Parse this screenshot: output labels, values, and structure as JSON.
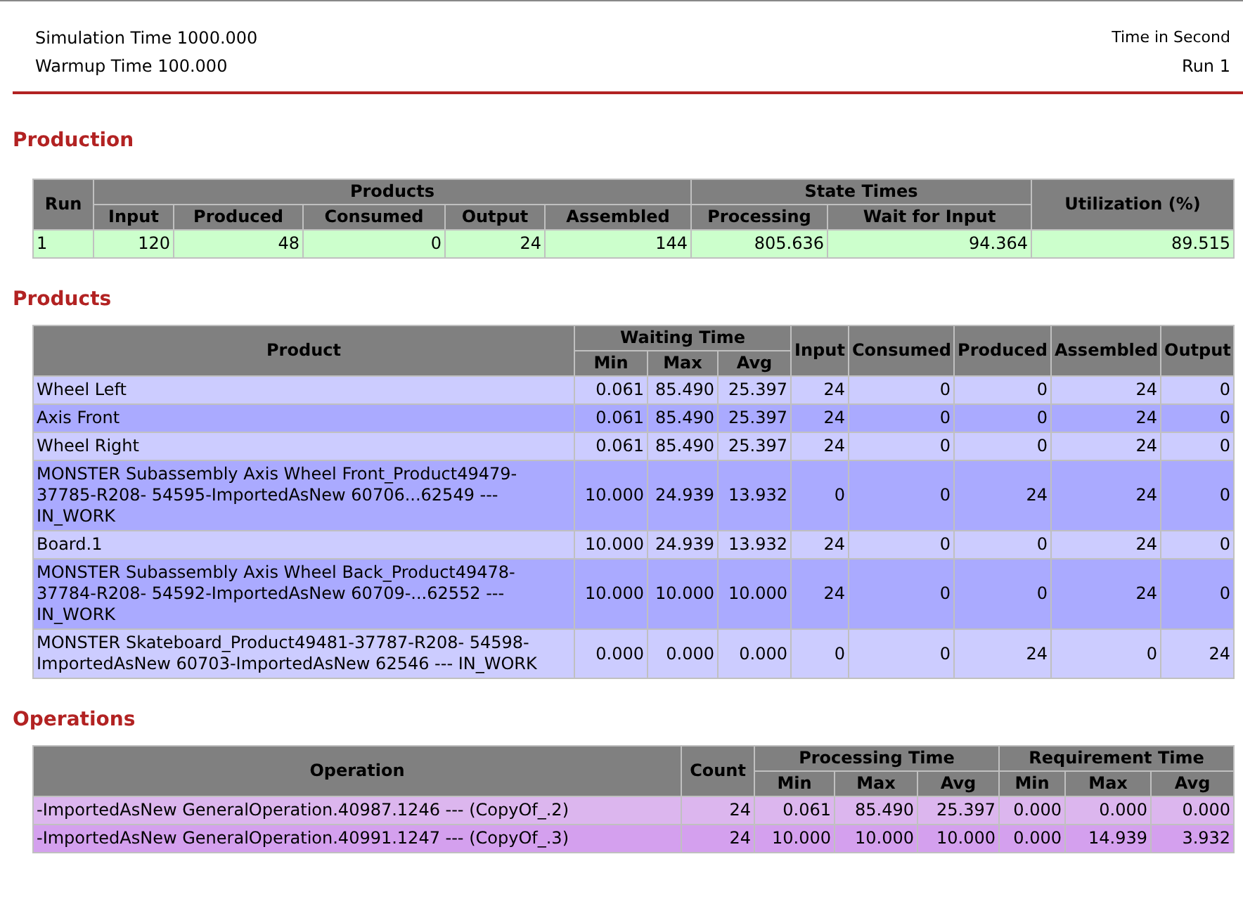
{
  "header": {
    "simulation_time": "Simulation Time 1000.000",
    "warmup_time": "Warmup Time 100.000",
    "time_unit": "Time in Second",
    "run": "Run 1"
  },
  "sections": [
    {
      "title": "Production",
      "table": {
        "header_rows": [
          [
            {
              "text": "Run",
              "rowspan": 2
            },
            {
              "text": "Products",
              "colspan": 5
            },
            {
              "text": "State Times",
              "colspan": 2
            },
            {
              "text": "Utilization (%)",
              "rowspan": 2
            }
          ],
          [
            {
              "text": "Input"
            },
            {
              "text": "Produced"
            },
            {
              "text": "Consumed"
            },
            {
              "text": "Output"
            },
            {
              "text": "Assembled"
            },
            {
              "text": "Processing"
            },
            {
              "text": "Wait for Input"
            }
          ]
        ],
        "rows": [
          [
            "1",
            "120",
            "48",
            "0",
            "24",
            "144",
            "805.636",
            "94.364",
            "89.515"
          ]
        ]
      }
    },
    {
      "title": "Products",
      "table": {
        "header_rows": [
          [
            {
              "text": "Product",
              "rowspan": 2
            },
            {
              "text": "Waiting Time",
              "colspan": 3
            },
            {
              "text": "Input",
              "rowspan": 2
            },
            {
              "text": "Consumed",
              "rowspan": 2
            },
            {
              "text": "Produced",
              "rowspan": 2
            },
            {
              "text": "Assembled",
              "rowspan": 2
            },
            {
              "text": "Output",
              "rowspan": 2
            }
          ],
          [
            {
              "text": "Min"
            },
            {
              "text": "Max"
            },
            {
              "text": "Avg"
            }
          ]
        ],
        "rows": [
          [
            "Wheel Left",
            "0.061",
            "85.490",
            "25.397",
            "24",
            "0",
            "0",
            "24",
            "0"
          ],
          [
            "Axis Front",
            "0.061",
            "85.490",
            "25.397",
            "24",
            "0",
            "0",
            "24",
            "0"
          ],
          [
            "Wheel Right",
            "0.061",
            "85.490",
            "25.397",
            "24",
            "0",
            "0",
            "24",
            "0"
          ],
          [
            "MONSTER Subassembly Axis Wheel Front_Product49479-37785-R208- 54595-ImportedAsNew 60706...62549 --- IN_WORK",
            "10.000",
            "24.939",
            "13.932",
            "0",
            "0",
            "24",
            "24",
            "0"
          ],
          [
            "Board.1",
            "10.000",
            "24.939",
            "13.932",
            "24",
            "0",
            "0",
            "24",
            "0"
          ],
          [
            "MONSTER Subassembly Axis Wheel Back_Product49478-37784-R208- 54592-ImportedAsNew 60709-...62552 --- IN_WORK",
            "10.000",
            "10.000",
            "10.000",
            "24",
            "0",
            "0",
            "24",
            "0"
          ],
          [
            "MONSTER Skateboard_Product49481-37787-R208- 54598-ImportedAsNew 60703-ImportedAsNew 62546 --- IN_WORK",
            "0.000",
            "0.000",
            "0.000",
            "0",
            "0",
            "24",
            "0",
            "24"
          ]
        ]
      }
    },
    {
      "title": "Operations",
      "table": {
        "header_rows": [
          [
            {
              "text": "Operation",
              "rowspan": 2
            },
            {
              "text": "Count",
              "rowspan": 2
            },
            {
              "text": "Processing Time",
              "colspan": 3
            },
            {
              "text": "Requirement Time",
              "colspan": 3
            }
          ],
          [
            {
              "text": "Min"
            },
            {
              "text": "Max"
            },
            {
              "text": "Avg"
            },
            {
              "text": "Min"
            },
            {
              "text": "Max"
            },
            {
              "text": "Avg"
            }
          ]
        ],
        "rows": [
          [
            "-ImportedAsNew GeneralOperation.40987.1246 --- (CopyOf_.2)",
            "24",
            "0.061",
            "85.490",
            "25.397",
            "0.000",
            "0.000",
            "0.000"
          ],
          [
            "-ImportedAsNew GeneralOperation.40991.1247 --- (CopyOf_.3)",
            "24",
            "10.000",
            "10.000",
            "10.000",
            "0.000",
            "14.939",
            "3.932"
          ]
        ]
      }
    }
  ]
}
